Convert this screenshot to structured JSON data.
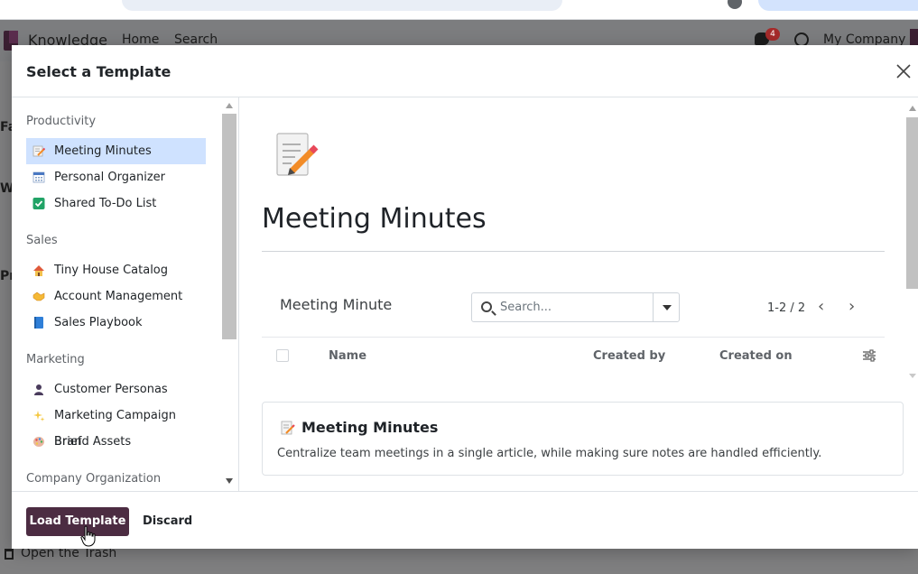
{
  "background_app": {
    "brand": "Knowledge",
    "nav": [
      "Home",
      "Search"
    ],
    "messages_badge": "4",
    "company": "My Company",
    "trash_label": "Open the Trash"
  },
  "modal": {
    "title": "Select a Template",
    "sidebar": {
      "sections": [
        {
          "label": "Productivity",
          "items": [
            {
              "label": "Meeting Minutes",
              "icon": "memo-icon",
              "active": true
            },
            {
              "label": "Personal Organizer",
              "icon": "calendar-icon",
              "active": false
            },
            {
              "label": "Shared To-Do List",
              "icon": "check-box-icon",
              "active": false
            }
          ]
        },
        {
          "label": "Sales",
          "items": [
            {
              "label": "Tiny House Catalog",
              "icon": "house-icon",
              "active": false
            },
            {
              "label": "Account Management",
              "icon": "handshake-icon",
              "active": false
            },
            {
              "label": "Sales Playbook",
              "icon": "blue-book-icon",
              "active": false
            }
          ]
        },
        {
          "label": "Marketing",
          "items": [
            {
              "label": "Customer Personas",
              "icon": "person-silhouette-icon",
              "active": false
            },
            {
              "label": "Marketing Campaign Brief",
              "icon": "sparkles-icon",
              "active": false
            },
            {
              "label": "Brand Assets",
              "icon": "palette-icon",
              "active": false
            }
          ]
        },
        {
          "label": "Company Organization",
          "items": []
        }
      ]
    },
    "preview": {
      "title": "Meeting Minutes",
      "list_label": "Meeting Minute",
      "search_placeholder": "Search...",
      "pager": "1-2 / 2",
      "columns": [
        "Name",
        "Created by",
        "Created on"
      ],
      "card": {
        "title": "Meeting Minutes",
        "description": "Centralize team meetings in a single article, while making sure notes are handled efficiently."
      }
    },
    "footer": {
      "load_label": "Load Template",
      "discard_label": "Discard"
    }
  },
  "colors": {
    "primary": "#4c2c42",
    "active_item_bg": "#cfe2ff",
    "badge": "#a52a2a"
  }
}
